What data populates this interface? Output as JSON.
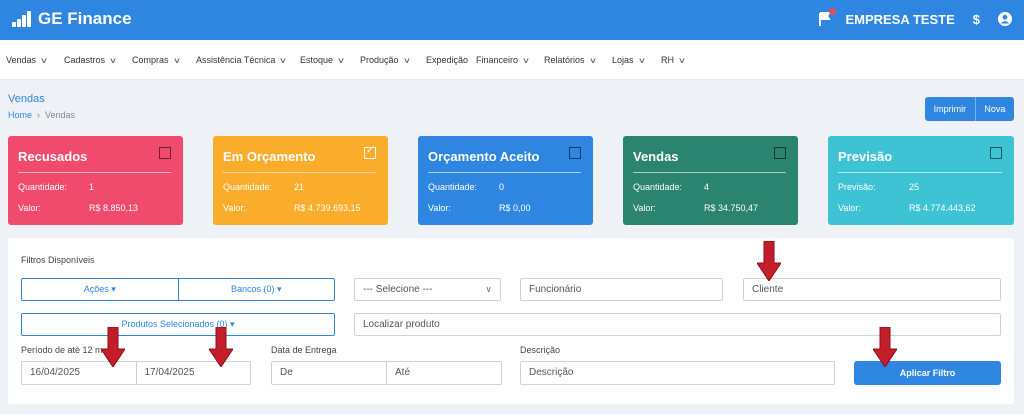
{
  "app": {
    "name": "GE Finance",
    "company": "EMPRESA TESTE",
    "currency_symbol": "$"
  },
  "menu": [
    {
      "label": "Vendas"
    },
    {
      "label": "Cadastros"
    },
    {
      "label": "Compras"
    },
    {
      "label": "Assistência Técnica"
    },
    {
      "label": "Estoque"
    },
    {
      "label": "Produção"
    },
    {
      "label": "Expedição"
    },
    {
      "label": "Financeiro"
    },
    {
      "label": "Relatórios"
    },
    {
      "label": "Lojas"
    },
    {
      "label": "RH"
    }
  ],
  "page": {
    "title": "Vendas",
    "breadcrumb_home": "Home",
    "breadcrumb_current": "Vendas"
  },
  "actions": {
    "print": "Imprimir",
    "new": "Nova"
  },
  "cards": [
    {
      "title": "Recusados",
      "r1_label": "Quantidade:",
      "r1_value": "1",
      "r2_label": "Valor:",
      "r2_value": "R$ 8.850,13",
      "color": "#f04a6c",
      "checked": false
    },
    {
      "title": "Em Orçamento",
      "r1_label": "Quantidade:",
      "r1_value": "21",
      "r2_label": "Valor:",
      "r2_value": "R$ 4.739.693,15",
      "color": "#f9ad2b",
      "checked": true
    },
    {
      "title": "Orçamento Aceito",
      "r1_label": "Quantidade:",
      "r1_value": "0",
      "r2_label": "Valor:",
      "r2_value": "R$ 0,00",
      "color": "#2f86e0",
      "checked": false
    },
    {
      "title": "Vendas",
      "r1_label": "Quantidade:",
      "r1_value": "4",
      "r2_label": "Valor:",
      "r2_value": "R$ 34.750,47",
      "color": "#2a8470",
      "checked": false
    },
    {
      "title": "Previsão",
      "r1_label": "Previsão:",
      "r1_value": "25",
      "r2_label": "Valor:",
      "r2_value": "R$ 4.774.443,62",
      "color": "#3ec3d4",
      "checked": false
    }
  ],
  "filters": {
    "title": "Filtros Disponíveis",
    "actions_label": "Ações",
    "banks_label": "Bancos (0)",
    "select_placeholder": "--- Selecione ---",
    "employee_placeholder": "Funcionário",
    "client_placeholder": "Cliente",
    "products_label": "Produtos Selecionados (0)",
    "product_search_placeholder": "Localizar produto",
    "period_label": "Período de até 12 m",
    "date_from": "16/04/2025",
    "date_to": "17/04/2025",
    "delivery_label": "Data de Entrega",
    "delivery_from_placeholder": "De",
    "delivery_to_placeholder": "Até",
    "description_label": "Descrição",
    "description_placeholder": "Descrição",
    "apply_label": "Aplicar Filtro"
  },
  "annotation_color": "#c41e2a"
}
